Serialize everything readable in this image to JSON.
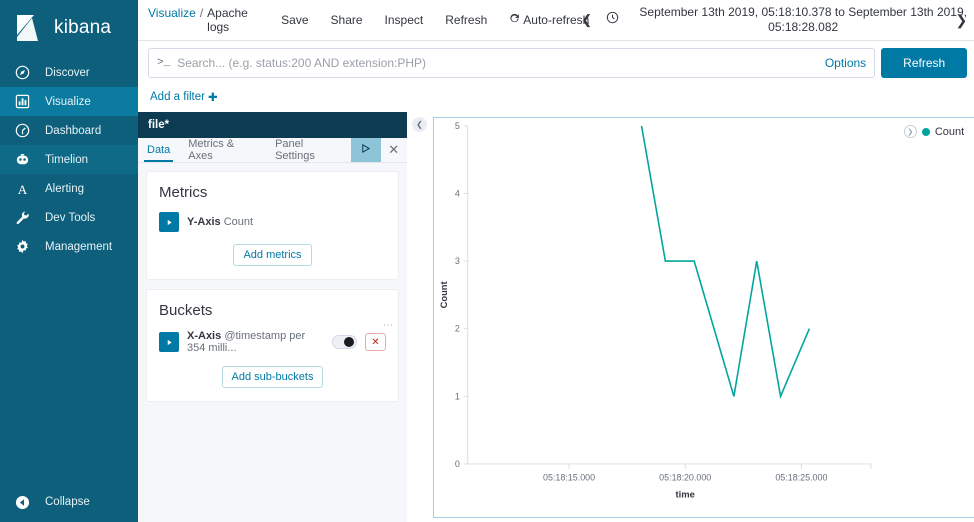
{
  "brand": {
    "name": "kibana"
  },
  "sidebar": {
    "items": [
      {
        "label": "Discover",
        "icon": "compass-icon",
        "selected": false
      },
      {
        "label": "Visualize",
        "icon": "bar-chart-icon",
        "selected": true
      },
      {
        "label": "Dashboard",
        "icon": "dashboard-icon",
        "selected": false
      },
      {
        "label": "Timelion",
        "icon": "timelion-icon",
        "selected": false
      },
      {
        "label": "Alerting",
        "icon": "alerting-icon",
        "selected": false
      },
      {
        "label": "Dev Tools",
        "icon": "wrench-icon",
        "selected": false
      },
      {
        "label": "Management",
        "icon": "gear-icon",
        "selected": false
      }
    ],
    "collapse_label": "Collapse"
  },
  "topnav": {
    "breadcrumb_root": "Visualize",
    "breadcrumb_sep": "/",
    "breadcrumb_current": "Apache logs",
    "save_label": "Save",
    "share_label": "Share",
    "inspect_label": "Inspect",
    "refresh_label": "Refresh",
    "auto_refresh_label": "Auto-refresh",
    "time_range": "September 13th 2019, 05:18:10.378 to September 13th 2019, 05:18:28.082"
  },
  "query": {
    "placeholder": "Search... (e.g. status:200 AND extension:PHP)",
    "value": "",
    "prompt": ">_",
    "options_label": "Options",
    "refresh_button": "Refresh",
    "add_filter_label": "Add a filter"
  },
  "editor": {
    "title": "file*",
    "tabs": [
      {
        "label": "Data",
        "active": true
      },
      {
        "label": "Metrics & Axes",
        "active": false
      },
      {
        "label": "Panel Settings",
        "active": false
      }
    ],
    "apply_icon": "play-icon",
    "close_icon": "close-icon",
    "metrics": {
      "heading": "Metrics",
      "agg_role": "Y-Axis",
      "agg_value": "Count",
      "add_label": "Add metrics"
    },
    "buckets": {
      "heading": "Buckets",
      "agg_role": "X-Axis",
      "agg_value": "@timestamp per 354 milli...",
      "add_label": "Add sub-buckets"
    }
  },
  "chart_data": {
    "type": "line",
    "title": "",
    "xlabel": "time",
    "ylabel": "Count",
    "ylim": [
      0,
      5
    ],
    "yticks": [
      0,
      1,
      2,
      3,
      4,
      5
    ],
    "xtick_labels": [
      "05:18:15.000",
      "05:18:20.000",
      "05:18:25.000"
    ],
    "grid": false,
    "legend": {
      "position": "top-right",
      "entries": [
        "Count"
      ]
    },
    "series": [
      {
        "name": "Count",
        "color": "#00a69b",
        "x": [
          "05:18:18.2",
          "05:18:19.3",
          "05:18:20.0",
          "05:18:21.1",
          "05:18:21.8",
          "05:18:22.6",
          "05:18:23.6"
        ],
        "values": [
          5,
          3,
          3,
          1,
          3,
          1,
          2
        ]
      }
    ]
  },
  "colors": {
    "accent": "#0079a5",
    "sidebar": "#0d5f7c",
    "sidebar_selected": "#0b7ca0",
    "series": "#00a69b",
    "danger": "#bd271e"
  }
}
